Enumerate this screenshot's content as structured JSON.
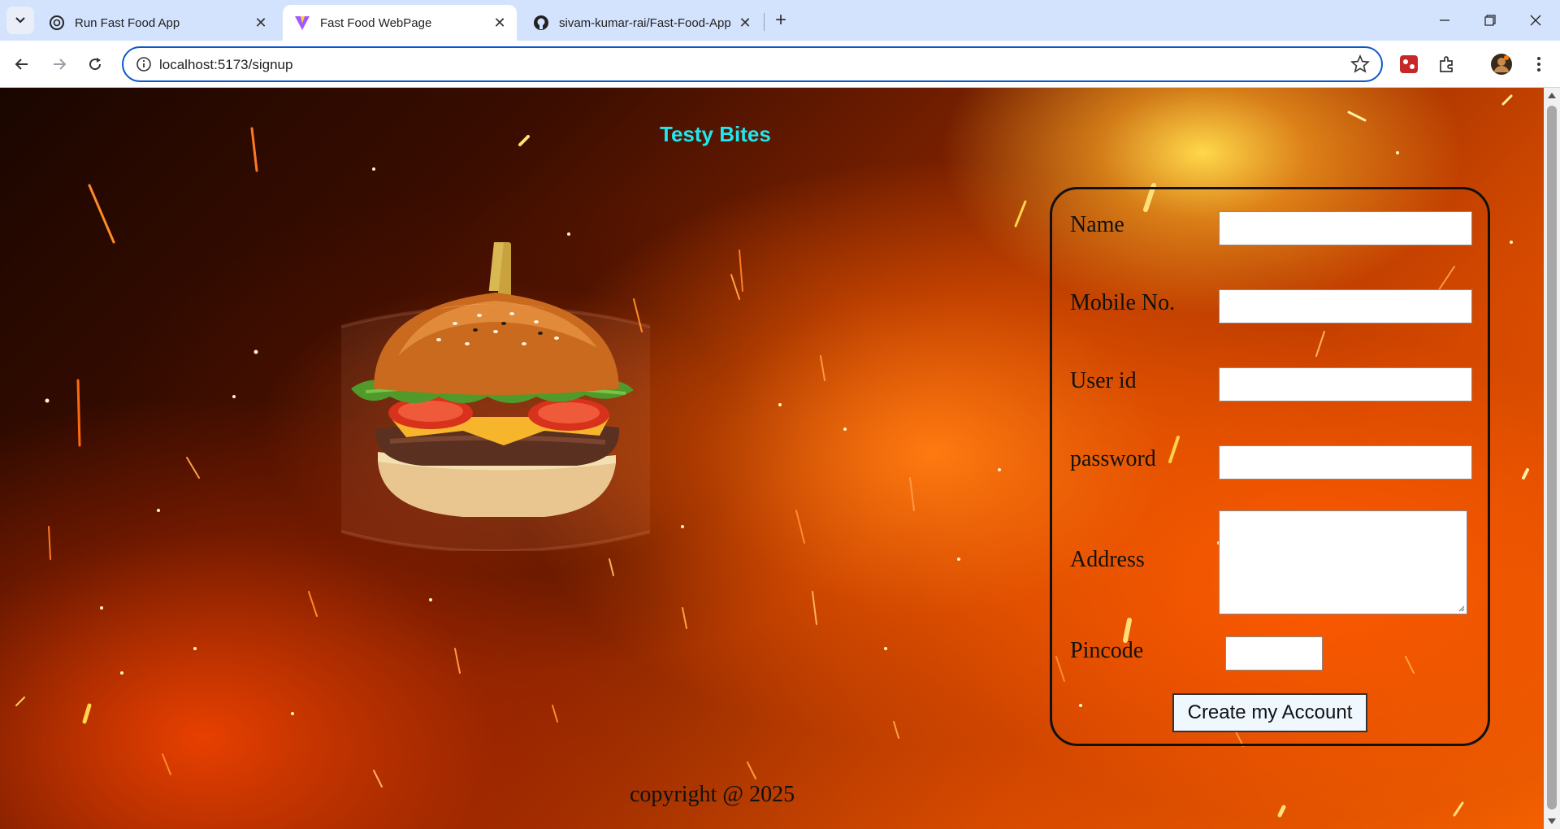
{
  "browser": {
    "tabs": [
      {
        "title": "Run Fast Food App",
        "icon": "openai-icon",
        "active": false
      },
      {
        "title": "Fast Food WebPage",
        "icon": "vite-icon",
        "active": true
      },
      {
        "title": "sivam-kumar-rai/Fast-Food-App",
        "icon": "github-icon",
        "active": false
      }
    ],
    "url": "localhost:5173/signup"
  },
  "page": {
    "site_title": "Testy Bites",
    "form": {
      "name_label": "Name",
      "mobile_label": "Mobile No.",
      "userid_label": "User id",
      "password_label": "password",
      "address_label": "Address",
      "pincode_label": "Pincode",
      "name_value": "",
      "mobile_value": "",
      "userid_value": "",
      "password_value": "",
      "address_value": "",
      "pincode_value": "",
      "submit_label": "Create my Account"
    },
    "footer": "copyright @ 2025"
  },
  "colors": {
    "title": "#22e6ee",
    "omnibox_border": "#0b57d0",
    "tabstrip": "#d3e3fd"
  }
}
